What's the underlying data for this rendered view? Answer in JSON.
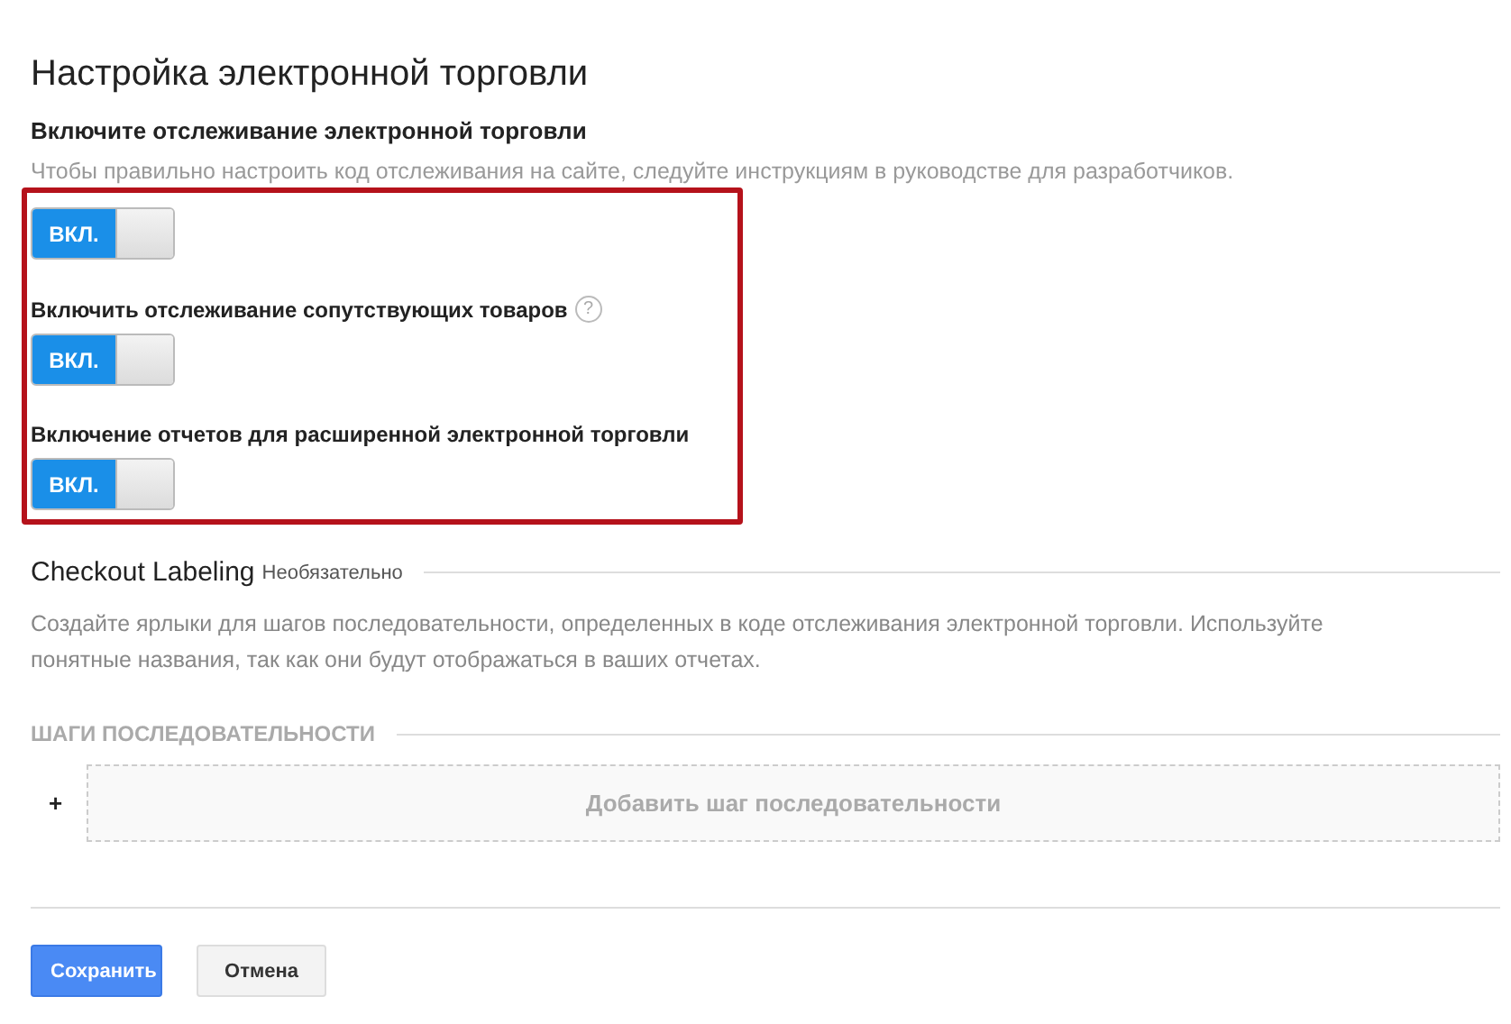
{
  "title": "Настройка электронной торговли",
  "tracking": {
    "label": "Включите отслеживание электронной торговли",
    "description": "Чтобы правильно настроить код отслеживания на сайте, следуйте инструкциям в руководстве для разработчиков."
  },
  "toggles": [
    {
      "on": true,
      "state_text": "ВКЛ."
    },
    {
      "label": "Включить отслеживание сопутствующих товаров",
      "help_icon": "?",
      "on": true,
      "state_text": "ВКЛ."
    },
    {
      "label": "Включение отчетов для расширенной электронной торговли",
      "on": true,
      "state_text": "ВКЛ."
    }
  ],
  "checkout": {
    "title": "Checkout Labeling",
    "optional": "Необязательно",
    "description": "Создайте ярлыки для шагов последовательности, определенных в коде отслеживания электронной торговли. Используйте понятные названия, так как они будут отображаться в ваших отчетах.",
    "steps_heading": "ШАГИ ПОСЛЕДОВАТЕЛЬНОСТИ",
    "add_icon": "+",
    "add_step": "Добавить шаг последовательности"
  },
  "buttons": [
    {
      "label": "Сохранить",
      "kind": "primary"
    },
    {
      "label": "Отмена",
      "kind": "secondary"
    }
  ]
}
